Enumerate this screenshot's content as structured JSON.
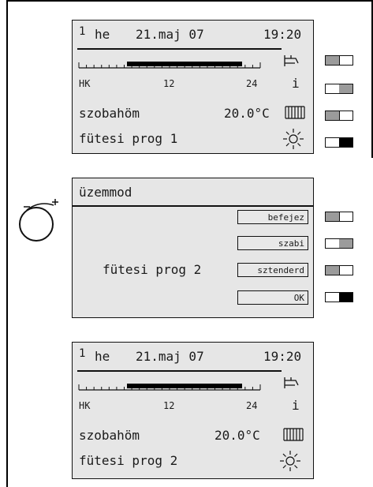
{
  "screen1": {
    "program_number": "1",
    "day": "he",
    "date": "21.maj 07",
    "time": "19:20",
    "scale_left": "HK",
    "scale_mid": "12",
    "scale_right": "24",
    "info": "i",
    "room_label": "szobahöm",
    "room_temp": "20.0°C",
    "program": "fütesi prog 1"
  },
  "menu": {
    "title": "üzemmod",
    "option_label": "fütesi prog 2",
    "softkeys": [
      "befejez",
      "szabi",
      "sztenderd",
      "OK"
    ]
  },
  "screen2": {
    "program_number": "1",
    "day": "he",
    "date": "21.maj 07",
    "time": "19:20",
    "scale_left": "HK",
    "scale_mid": "12",
    "scale_right": "24",
    "info": "i",
    "room_label": "szobahöm",
    "room_temp": "20.0°C",
    "program": "fütesi prog 2"
  },
  "icons": [
    "tap-icon",
    "radiator-icon",
    "sun-icon",
    "rotary-knob-icon"
  ],
  "colors": {
    "lcd_background": "#e6e6e6",
    "button_gray": "#9b9b9b",
    "outline": "#111111"
  }
}
